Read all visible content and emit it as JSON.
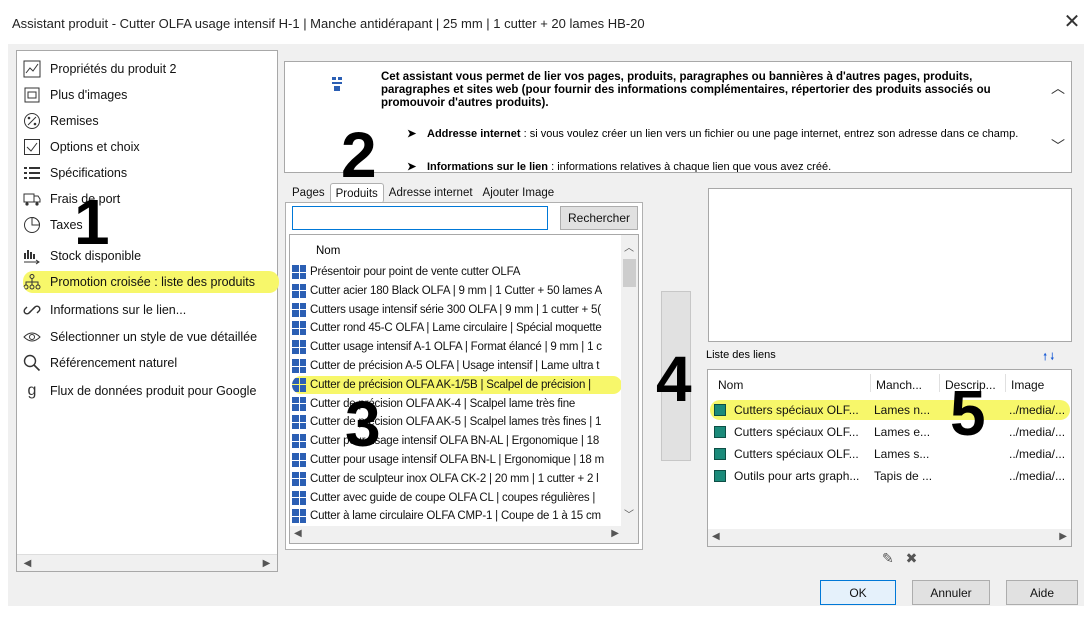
{
  "window": {
    "title": "Assistant produit - Cutter OLFA usage intensif H-1 | Manche antidérapant | 25 mm | 1 cutter + 20 lames HB-20",
    "close_glyph": "✕"
  },
  "sidebar": {
    "items": [
      {
        "label": "Propriétés du produit 2",
        "icon": "properties-icon"
      },
      {
        "label": "Plus d'images",
        "icon": "images-icon"
      },
      {
        "label": "Remises",
        "icon": "percent-icon"
      },
      {
        "label": "Options et choix",
        "icon": "checkbox-icon"
      },
      {
        "label": "Spécifications",
        "icon": "list-icon"
      },
      {
        "label": "Frais de port",
        "icon": "truck-icon"
      },
      {
        "label": "Taxes",
        "icon": "pie-icon"
      },
      {
        "label": "Stock disponible",
        "icon": "stock-icon"
      },
      {
        "label": "Promotion croisée : liste des produits",
        "icon": "cross-promo-icon"
      },
      {
        "label": "Informations sur le lien...",
        "icon": "link-icon"
      },
      {
        "label": "Sélectionner un style de vue détaillée",
        "icon": "eye-icon"
      },
      {
        "label": "Référencement naturel",
        "icon": "magnifier-icon"
      },
      {
        "label": "Flux de données produit pour Google",
        "icon": "google-icon"
      }
    ]
  },
  "info": {
    "intro": "Cet assistant vous permet de lier vos pages, produits, paragraphes ou bannières à d'autres pages, produits, paragraphes et sites web (pour fournir des informations complémentaires, répertorier des produits associés ou promouvoir d'autres produits).",
    "bullet1_title": "Addresse internet",
    "bullet1_text": " : si vous voulez créer un lien vers un fichier ou une page internet, entrez son adresse dans ce champ.",
    "bullet2_title": "Informations sur le lien",
    "bullet2_text": " : informations relatives à chaque lien que vous avez créé."
  },
  "tabs": [
    "Pages",
    "Produits",
    "Adresse internet",
    "Ajouter Image"
  ],
  "search": {
    "value": "",
    "button": "Rechercher"
  },
  "products": {
    "header": "Nom",
    "rows": [
      "Présentoir pour point de vente cutter OLFA",
      "Cutter acier 180 Black OLFA | 9 mm | 1 Cutter + 50 lames A",
      "Cutters usage intensif série 300 OLFA | 9 mm | 1 cutter + 5(",
      "Cutter rond 45-C OLFA | Lame circulaire | Spécial moquette",
      "Cutter usage intensif A-1 OLFA | Format élancé | 9 mm | 1 c",
      "Cutter de précision A-5 OLFA | Usage intensif | Lame ultra t",
      "Cutter de précision OLFA AK-1/5B | Scalpel de précision |",
      "Cutter de précision OLFA AK-4 | Scalpel lame très fine",
      "Cutter de précision OLFA AK-5 | Scalpel lames très fines | 1",
      "Cutter pour usage intensif OLFA BN-AL | Ergonomique | 18",
      "Cutter pour usage intensif OLFA BN-L | Ergonomique | 18 m",
      "Cutter de sculpteur inox OLFA CK-2 | 20 mm | 1 cutter + 2 l",
      "Cutter avec guide de coupe OLFA CL | coupes régulières |",
      "Cutter à lame circulaire OLFA CMP-1 | Coupe de 1 à 15 cm"
    ]
  },
  "links": {
    "label": "Liste des liens",
    "arrows": "🠕 🠗",
    "headers": [
      "Nom",
      "Manch...",
      "Descrip...",
      "Image"
    ],
    "rows": [
      [
        "Cutters spéciaux OLF...",
        "Lames n...",
        "",
        "../media/..."
      ],
      [
        "Cutters spéciaux OLF...",
        "Lames e...",
        "",
        "../media/..."
      ],
      [
        "Cutters spéciaux OLF...",
        "Lames s...",
        "",
        "../media/..."
      ],
      [
        "Outils pour arts graph...",
        "Tapis de ...",
        "",
        "../media/..."
      ]
    ]
  },
  "buttons": {
    "ok": "OK",
    "cancel": "Annuler",
    "help": "Aide"
  },
  "annotations": [
    "1",
    "2",
    "3",
    "4",
    "5"
  ],
  "colors": {
    "highlight": "#f7f76a",
    "accent": "#0078d7",
    "icon_blue": "#2b5fb4",
    "link_green": "#1b8a7a"
  }
}
